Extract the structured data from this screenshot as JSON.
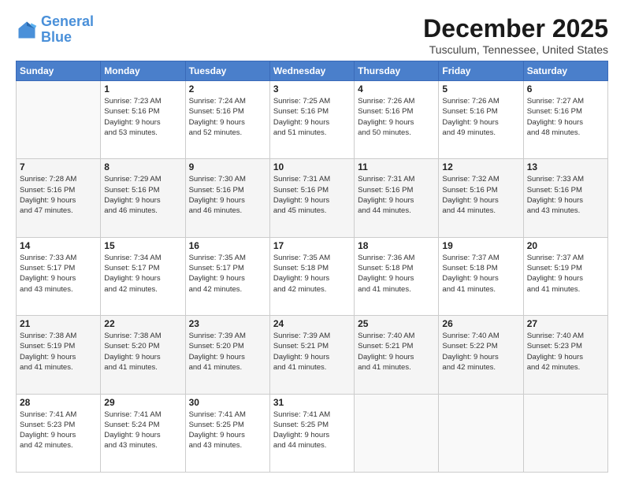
{
  "logo": {
    "line1": "General",
    "line2": "Blue"
  },
  "title": "December 2025",
  "subtitle": "Tusculum, Tennessee, United States",
  "weekdays": [
    "Sunday",
    "Monday",
    "Tuesday",
    "Wednesday",
    "Thursday",
    "Friday",
    "Saturday"
  ],
  "weeks": [
    [
      {
        "day": "",
        "info": ""
      },
      {
        "day": "1",
        "info": "Sunrise: 7:23 AM\nSunset: 5:16 PM\nDaylight: 9 hours\nand 53 minutes."
      },
      {
        "day": "2",
        "info": "Sunrise: 7:24 AM\nSunset: 5:16 PM\nDaylight: 9 hours\nand 52 minutes."
      },
      {
        "day": "3",
        "info": "Sunrise: 7:25 AM\nSunset: 5:16 PM\nDaylight: 9 hours\nand 51 minutes."
      },
      {
        "day": "4",
        "info": "Sunrise: 7:26 AM\nSunset: 5:16 PM\nDaylight: 9 hours\nand 50 minutes."
      },
      {
        "day": "5",
        "info": "Sunrise: 7:26 AM\nSunset: 5:16 PM\nDaylight: 9 hours\nand 49 minutes."
      },
      {
        "day": "6",
        "info": "Sunrise: 7:27 AM\nSunset: 5:16 PM\nDaylight: 9 hours\nand 48 minutes."
      }
    ],
    [
      {
        "day": "7",
        "info": "Sunrise: 7:28 AM\nSunset: 5:16 PM\nDaylight: 9 hours\nand 47 minutes."
      },
      {
        "day": "8",
        "info": "Sunrise: 7:29 AM\nSunset: 5:16 PM\nDaylight: 9 hours\nand 46 minutes."
      },
      {
        "day": "9",
        "info": "Sunrise: 7:30 AM\nSunset: 5:16 PM\nDaylight: 9 hours\nand 46 minutes."
      },
      {
        "day": "10",
        "info": "Sunrise: 7:31 AM\nSunset: 5:16 PM\nDaylight: 9 hours\nand 45 minutes."
      },
      {
        "day": "11",
        "info": "Sunrise: 7:31 AM\nSunset: 5:16 PM\nDaylight: 9 hours\nand 44 minutes."
      },
      {
        "day": "12",
        "info": "Sunrise: 7:32 AM\nSunset: 5:16 PM\nDaylight: 9 hours\nand 44 minutes."
      },
      {
        "day": "13",
        "info": "Sunrise: 7:33 AM\nSunset: 5:16 PM\nDaylight: 9 hours\nand 43 minutes."
      }
    ],
    [
      {
        "day": "14",
        "info": "Sunrise: 7:33 AM\nSunset: 5:17 PM\nDaylight: 9 hours\nand 43 minutes."
      },
      {
        "day": "15",
        "info": "Sunrise: 7:34 AM\nSunset: 5:17 PM\nDaylight: 9 hours\nand 42 minutes."
      },
      {
        "day": "16",
        "info": "Sunrise: 7:35 AM\nSunset: 5:17 PM\nDaylight: 9 hours\nand 42 minutes."
      },
      {
        "day": "17",
        "info": "Sunrise: 7:35 AM\nSunset: 5:18 PM\nDaylight: 9 hours\nand 42 minutes."
      },
      {
        "day": "18",
        "info": "Sunrise: 7:36 AM\nSunset: 5:18 PM\nDaylight: 9 hours\nand 41 minutes."
      },
      {
        "day": "19",
        "info": "Sunrise: 7:37 AM\nSunset: 5:18 PM\nDaylight: 9 hours\nand 41 minutes."
      },
      {
        "day": "20",
        "info": "Sunrise: 7:37 AM\nSunset: 5:19 PM\nDaylight: 9 hours\nand 41 minutes."
      }
    ],
    [
      {
        "day": "21",
        "info": "Sunrise: 7:38 AM\nSunset: 5:19 PM\nDaylight: 9 hours\nand 41 minutes."
      },
      {
        "day": "22",
        "info": "Sunrise: 7:38 AM\nSunset: 5:20 PM\nDaylight: 9 hours\nand 41 minutes."
      },
      {
        "day": "23",
        "info": "Sunrise: 7:39 AM\nSunset: 5:20 PM\nDaylight: 9 hours\nand 41 minutes."
      },
      {
        "day": "24",
        "info": "Sunrise: 7:39 AM\nSunset: 5:21 PM\nDaylight: 9 hours\nand 41 minutes."
      },
      {
        "day": "25",
        "info": "Sunrise: 7:40 AM\nSunset: 5:21 PM\nDaylight: 9 hours\nand 41 minutes."
      },
      {
        "day": "26",
        "info": "Sunrise: 7:40 AM\nSunset: 5:22 PM\nDaylight: 9 hours\nand 42 minutes."
      },
      {
        "day": "27",
        "info": "Sunrise: 7:40 AM\nSunset: 5:23 PM\nDaylight: 9 hours\nand 42 minutes."
      }
    ],
    [
      {
        "day": "28",
        "info": "Sunrise: 7:41 AM\nSunset: 5:23 PM\nDaylight: 9 hours\nand 42 minutes."
      },
      {
        "day": "29",
        "info": "Sunrise: 7:41 AM\nSunset: 5:24 PM\nDaylight: 9 hours\nand 43 minutes."
      },
      {
        "day": "30",
        "info": "Sunrise: 7:41 AM\nSunset: 5:25 PM\nDaylight: 9 hours\nand 43 minutes."
      },
      {
        "day": "31",
        "info": "Sunrise: 7:41 AM\nSunset: 5:25 PM\nDaylight: 9 hours\nand 44 minutes."
      },
      {
        "day": "",
        "info": ""
      },
      {
        "day": "",
        "info": ""
      },
      {
        "day": "",
        "info": ""
      }
    ]
  ]
}
